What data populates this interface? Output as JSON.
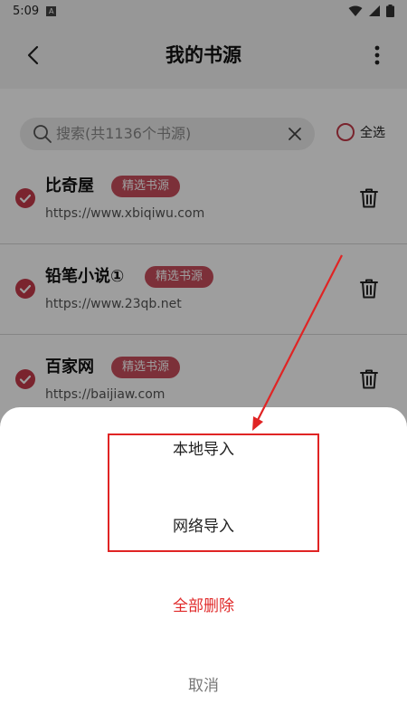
{
  "status_bar": {
    "time": "5:09",
    "notification_icon": "A"
  },
  "app_bar": {
    "title": "我的书源",
    "back_icon": "chevron-left",
    "menu_icon": "more-vertical"
  },
  "search": {
    "placeholder": "搜索(共1136个书源)",
    "select_all_label": "全选"
  },
  "sources": [
    {
      "name": "比奇屋",
      "badge": "精选书源",
      "url": "https://www.xbiqiwu.com",
      "checked": true
    },
    {
      "name": "铅笔小说①",
      "badge": "精选书源",
      "url": "https://www.23qb.net",
      "checked": true
    },
    {
      "name": "百家网",
      "badge": "精选书源",
      "url": "https://baijiaw.com",
      "checked": true
    }
  ],
  "sheet": {
    "local_import": "本地导入",
    "network_import": "网络导入",
    "delete_all": "全部删除",
    "cancel": "取消"
  },
  "colors": {
    "accent": "#c53a4b",
    "badge": "#c84e5c",
    "danger": "#e02a2a",
    "annotation": "#e02424"
  }
}
